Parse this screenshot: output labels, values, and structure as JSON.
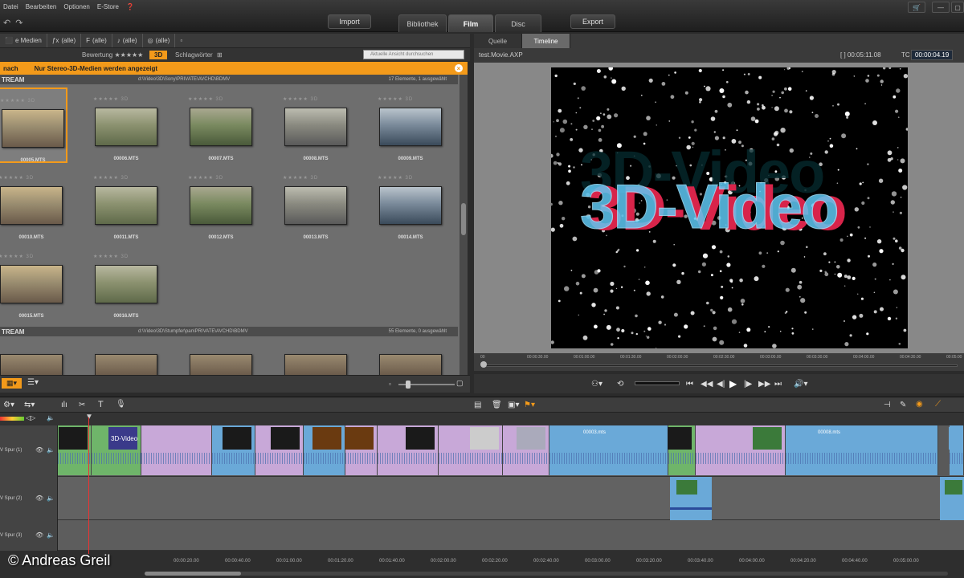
{
  "menu": [
    "Datei",
    "Bearbeiten",
    "Optionen",
    "E-Store"
  ],
  "top": {
    "import": "Import",
    "export": "Export",
    "tabs": [
      "Bibliothek",
      "Film",
      "Disc"
    ],
    "active_tab": "Film"
  },
  "library": {
    "filters": [
      {
        "icon": "⬛",
        "label": "e Medien"
      },
      {
        "icon": "ƒx",
        "label": "(alle)"
      },
      {
        "icon": "F",
        "label": "(alle)"
      },
      {
        "icon": "♪",
        "label": "(alle)"
      },
      {
        "icon": "◎",
        "label": "(alle)"
      }
    ],
    "rating_label": "Bewertung ★★★★★",
    "threed_label": "3D",
    "keywords_label": "Schlagwörter",
    "search_placeholder": "Aktuelle Ansicht durchsuchen",
    "notice": "Nur Stereo-3D-Medien werden angezeigt",
    "notice_prefix": "nach",
    "group1": {
      "title": "TREAM",
      "path": "d:\\Video\\3D\\Sony\\PRIVATE\\AVCHD\\BDMV",
      "count": "17 Elemente, 1 ausgewählt"
    },
    "group2": {
      "title": "TREAM",
      "path": "d:\\Video\\3D\\Stumpfer\\pan\\PRIVATE\\AVCHD\\BDMV",
      "count": "55 Elemente, 0 ausgewählt"
    },
    "clips_row1": [
      "00005.MTS",
      "00006.MTS",
      "00007.MTS",
      "00008.MTS",
      "00009.MTS"
    ],
    "clips_row2": [
      "00010.MTS",
      "00011.MTS",
      "00012.MTS",
      "00013.MTS",
      "00014.MTS"
    ],
    "clips_row3": [
      "00015.MTS",
      "00016.MTS"
    ],
    "stars_label": "★★★★★ 3D"
  },
  "player": {
    "tabs": [
      "Quelle",
      "Timeline"
    ],
    "active": "Timeline",
    "filename": "test.Movie.AXP",
    "duration": "[ ] 00:05:11.08",
    "tc_label": "TC",
    "timecode": "00:00:04.19",
    "title_text": "3D-Video",
    "ruler": [
      "00",
      "00:00:30.00",
      "00:01:00.00",
      "00:01:30.00",
      "00:02:00.00",
      "00:02:30.00",
      "00:03:00.00",
      "00:03:30.00",
      "00:04:00.00",
      "00:04:30.00",
      "00:05:00"
    ]
  },
  "timeline": {
    "tracks": [
      {
        "label": "V Spur (1)"
      },
      {
        "label": "V Spur (2)"
      },
      {
        "label": "V Spur (3)"
      }
    ],
    "clip_labels": [
      "3D-Video",
      "00003.mts",
      "00008.mts"
    ],
    "ruler": [
      "00:00:20.00",
      "00:00:40.00",
      "00:01:00.00",
      "00:01:20.00",
      "00:01:40.00",
      "00:02:00.00",
      "00:02:20.00",
      "00:02:40.00",
      "00:03:00.00",
      "00:03:20.00",
      "00:03:40.00",
      "00:04:00.00",
      "00:04:20.00",
      "00:04:40.00",
      "00:05:00.00"
    ]
  },
  "copyright": "© Andreas Greil"
}
